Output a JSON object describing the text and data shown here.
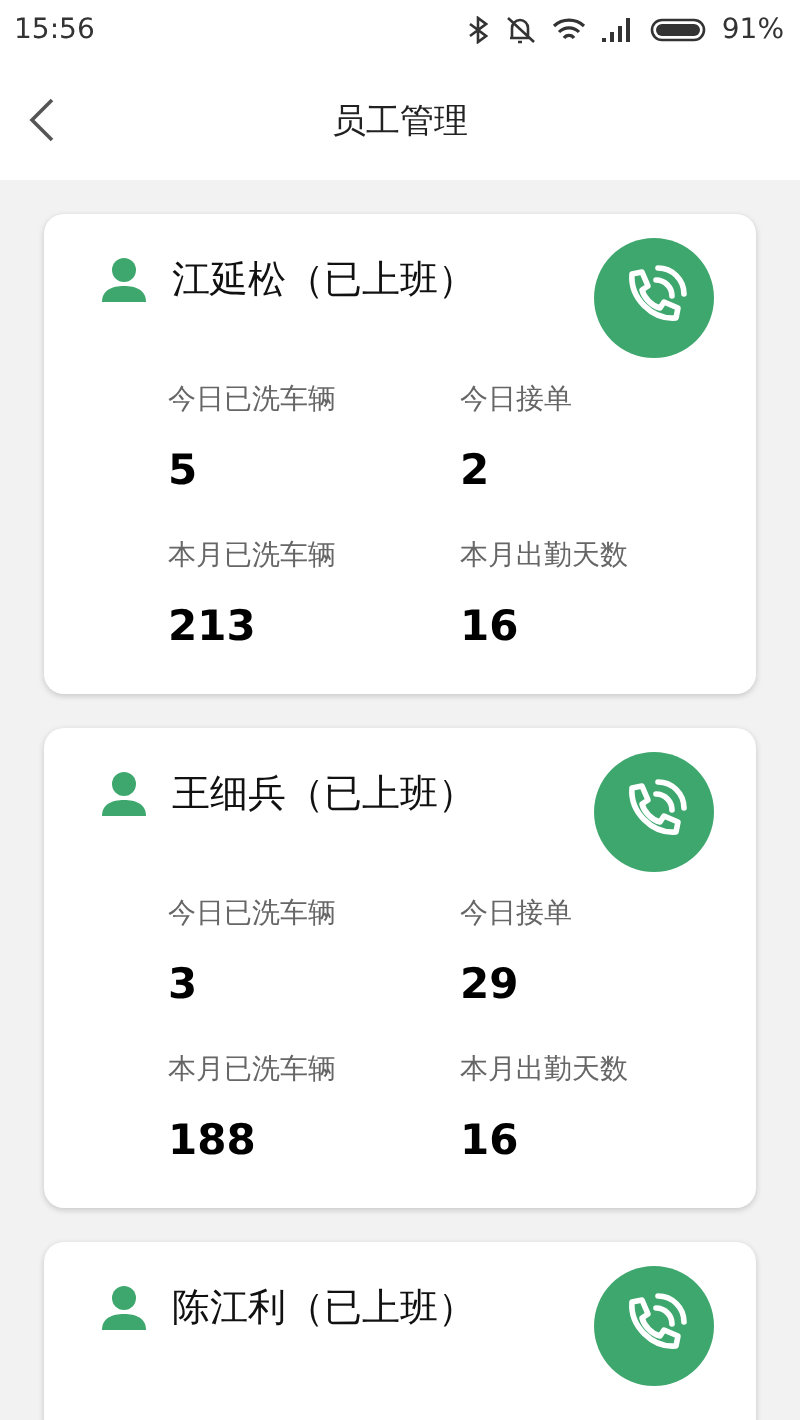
{
  "status_bar": {
    "time": "15:56",
    "battery": "91%"
  },
  "header": {
    "title": "员工管理"
  },
  "employees": [
    {
      "name": "江延松（已上班）",
      "stats": [
        {
          "label": "今日已洗车辆",
          "value": "5"
        },
        {
          "label": "今日接单",
          "value": "2"
        },
        {
          "label": "本月已洗车辆",
          "value": "213"
        },
        {
          "label": "本月出勤天数",
          "value": "16"
        }
      ]
    },
    {
      "name": "王细兵（已上班）",
      "stats": [
        {
          "label": "今日已洗车辆",
          "value": "3"
        },
        {
          "label": "今日接单",
          "value": "29"
        },
        {
          "label": "本月已洗车辆",
          "value": "188"
        },
        {
          "label": "本月出勤天数",
          "value": "16"
        }
      ]
    },
    {
      "name": "陈江利（已上班）"
    }
  ]
}
